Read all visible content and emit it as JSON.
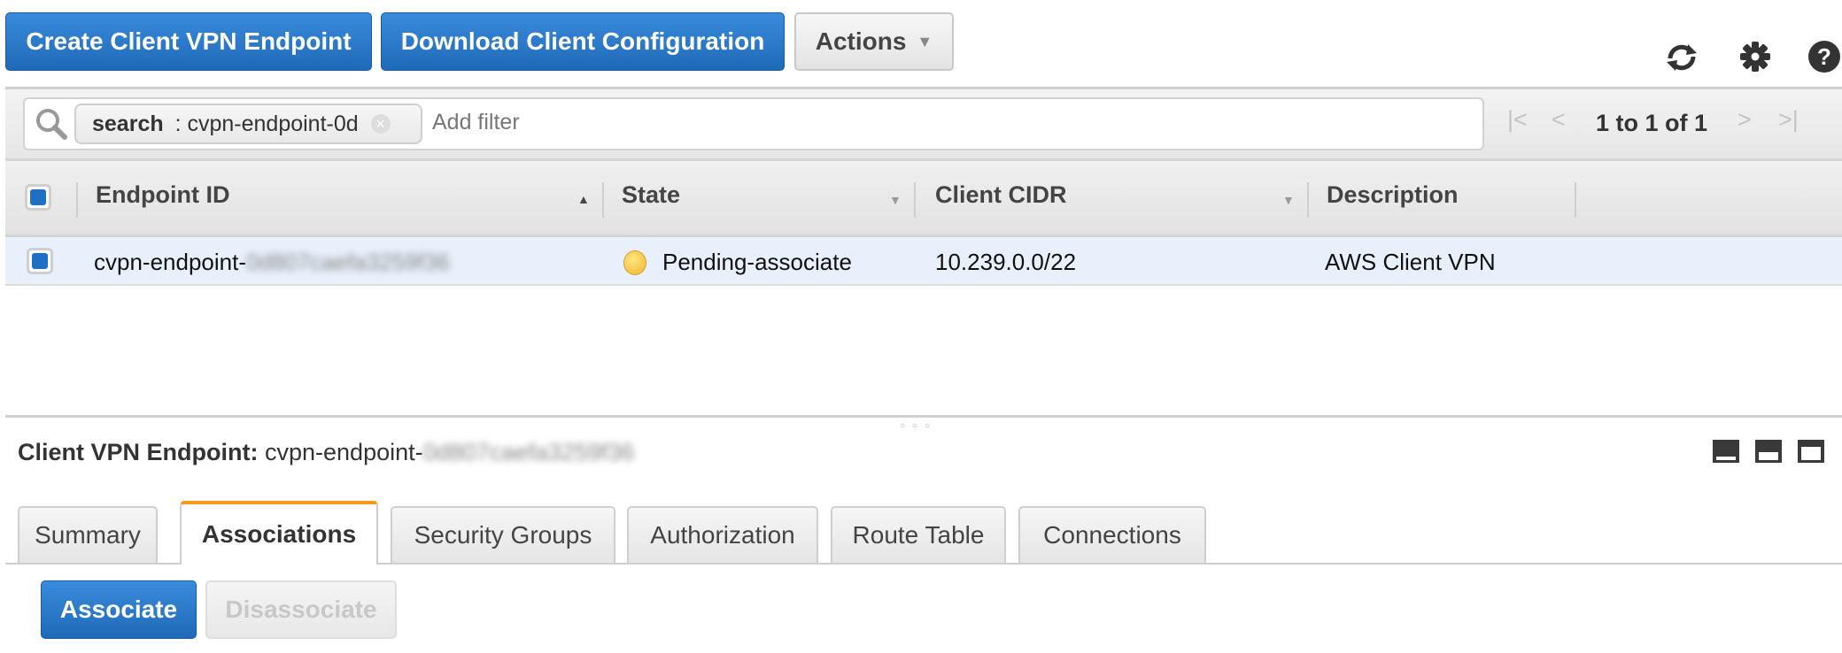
{
  "toolbar": {
    "create_label": "Create Client VPN Endpoint",
    "download_label": "Download Client Configuration",
    "actions_label": "Actions",
    "icons": [
      "refresh-icon",
      "gear-icon",
      "help-icon"
    ]
  },
  "filter": {
    "token_key": "search",
    "token_sep": " : ",
    "token_value": "cvpn-endpoint-0d",
    "placeholder": "Add filter"
  },
  "pagination": {
    "label": "1 to 1 of 1"
  },
  "table": {
    "columns": [
      {
        "label": "Endpoint ID",
        "sort": "ascending"
      },
      {
        "label": "State",
        "sort": "none"
      },
      {
        "label": "Client CIDR",
        "sort": "none"
      },
      {
        "label": "Description",
        "sort": "none"
      }
    ],
    "rows": [
      {
        "endpoint_prefix": "cvpn-endpoint-",
        "endpoint_redacted": "0d807caefa3259f36",
        "state": "Pending-associate",
        "state_color": "#f5c242",
        "client_cidr": "10.239.0.0/22",
        "description": "AWS Client VPN",
        "selected": true
      }
    ]
  },
  "detail": {
    "title_label": "Client VPN Endpoint:",
    "title_prefix": "cvpn-endpoint-",
    "title_redacted": "0d807caefa3259f36",
    "tabs": [
      {
        "label": "Summary",
        "active": false
      },
      {
        "label": "Associations",
        "active": true
      },
      {
        "label": "Security Groups",
        "active": false
      },
      {
        "label": "Authorization",
        "active": false
      },
      {
        "label": "Route Table",
        "active": false
      },
      {
        "label": "Connections",
        "active": false
      }
    ],
    "associate_label": "Associate",
    "disassociate_label": "Disassociate"
  },
  "colors": {
    "primary": "#1f6ab8",
    "active_tab_accent": "#f7981d",
    "selected_row": "#e8f0fb"
  }
}
